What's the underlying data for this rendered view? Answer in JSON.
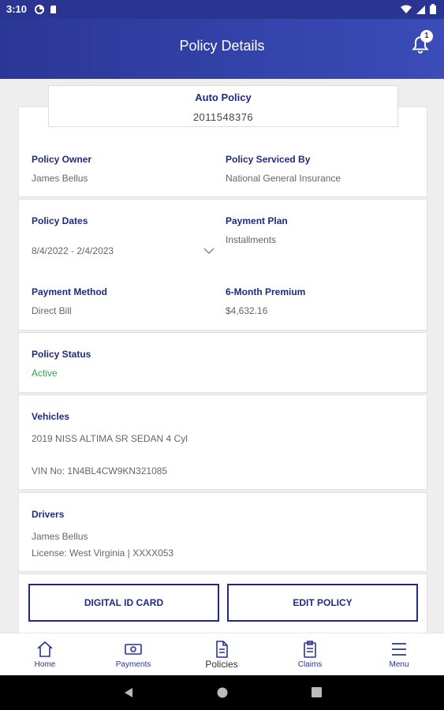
{
  "status_bar": {
    "time": "3:10"
  },
  "header": {
    "title": "Policy Details",
    "notification_count": "1"
  },
  "policy": {
    "type": "Auto Policy",
    "number": "2011548376"
  },
  "owner": {
    "owner_label": "Policy Owner",
    "owner_value": "James Bellus",
    "serviced_label": "Policy Serviced By",
    "serviced_value": "National General Insurance"
  },
  "dates": {
    "dates_label": "Policy Dates",
    "dates_value": "8/4/2022 - 2/4/2023",
    "plan_label": "Payment Plan",
    "plan_value": "Installments",
    "method_label": "Payment Method",
    "method_value": "Direct Bill",
    "premium_label": "6-Month Premium",
    "premium_value": "$4,632.16"
  },
  "status": {
    "label": "Policy Status",
    "value": "Active",
    "color": "#2ea44f"
  },
  "vehicles": {
    "label": "Vehicles",
    "vehicle": "2019 NISS ALTIMA SR SEDAN 4 Cyl",
    "vin": "VIN No: 1N4BL4CW9KN321085"
  },
  "drivers": {
    "label": "Drivers",
    "name": "James Bellus",
    "license": "License: West Virginia | XXXX053"
  },
  "actions": {
    "digital_id": "DIGITAL ID CARD",
    "edit_policy": "EDIT POLICY"
  },
  "bottom_nav": {
    "home": "Home",
    "payments": "Payments",
    "policies": "Policies",
    "claims": "Claims",
    "menu": "Menu"
  },
  "colors": {
    "brand": "#2a3491",
    "label": "#1f2a80"
  }
}
